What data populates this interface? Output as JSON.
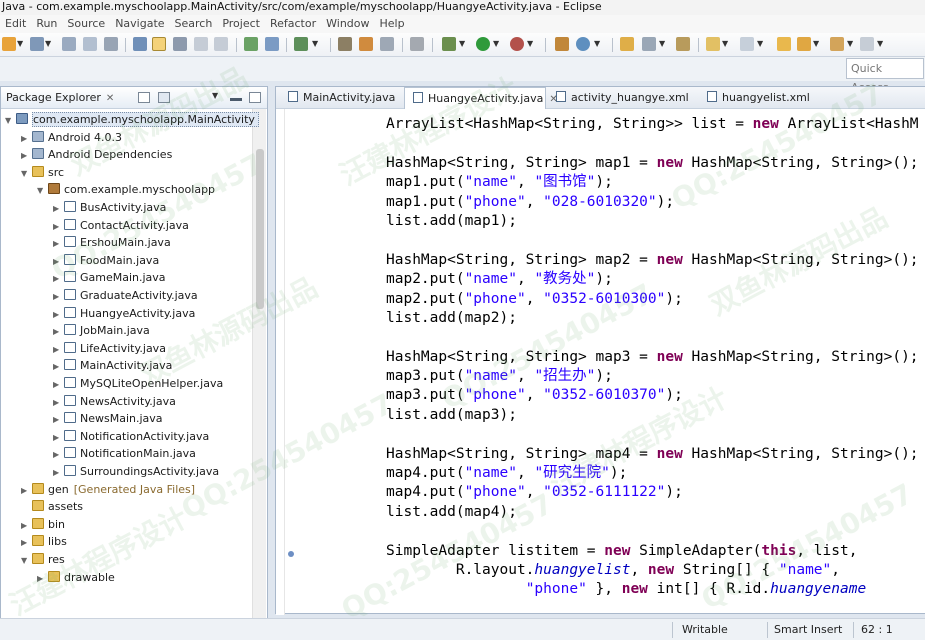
{
  "title": "Java - com.example.myschoolapp.MainActivity/src/com/example/myschoolapp/HuangyeActivity.java - Eclipse",
  "menu": [
    "Edit",
    "Run",
    "Source",
    "Navigate",
    "Search",
    "Project",
    "Refactor",
    "Window",
    "Help"
  ],
  "quick_access": "Quick Access",
  "package_explorer": {
    "tab_label": "Package Explorer",
    "tree": [
      {
        "label": "com.example.myschoolapp.MainActivity",
        "indent": 0,
        "icon": "project-icon",
        "arrow": "▼",
        "selected": true
      },
      {
        "label": "Android 4.0.3",
        "indent": 1,
        "icon": "library-icon",
        "arrow": "▶"
      },
      {
        "label": "Android Dependencies",
        "indent": 1,
        "icon": "library-icon",
        "arrow": "▶"
      },
      {
        "label": "src",
        "indent": 1,
        "icon": "folder-icon",
        "arrow": "▼"
      },
      {
        "label": "com.example.myschoolapp",
        "indent": 2,
        "icon": "package-icon",
        "arrow": "▼"
      },
      {
        "label": "BusActivity.java",
        "indent": 3,
        "icon": "java-file-icon",
        "arrow": "▶"
      },
      {
        "label": "ContactActivity.java",
        "indent": 3,
        "icon": "java-file-icon",
        "arrow": "▶"
      },
      {
        "label": "ErshouMain.java",
        "indent": 3,
        "icon": "java-file-icon",
        "arrow": "▶"
      },
      {
        "label": "FoodMain.java",
        "indent": 3,
        "icon": "java-file-icon",
        "arrow": "▶"
      },
      {
        "label": "GameMain.java",
        "indent": 3,
        "icon": "java-file-icon",
        "arrow": "▶"
      },
      {
        "label": "GraduateActivity.java",
        "indent": 3,
        "icon": "java-file-icon",
        "arrow": "▶"
      },
      {
        "label": "HuangyeActivity.java",
        "indent": 3,
        "icon": "java-file-icon",
        "arrow": "▶"
      },
      {
        "label": "JobMain.java",
        "indent": 3,
        "icon": "java-file-icon",
        "arrow": "▶"
      },
      {
        "label": "LifeActivity.java",
        "indent": 3,
        "icon": "java-file-icon",
        "arrow": "▶"
      },
      {
        "label": "MainActivity.java",
        "indent": 3,
        "icon": "java-file-icon",
        "arrow": "▶"
      },
      {
        "label": "MySQLiteOpenHelper.java",
        "indent": 3,
        "icon": "java-file-icon",
        "arrow": "▶"
      },
      {
        "label": "NewsActivity.java",
        "indent": 3,
        "icon": "java-file-icon",
        "arrow": "▶"
      },
      {
        "label": "NewsMain.java",
        "indent": 3,
        "icon": "java-file-icon",
        "arrow": "▶"
      },
      {
        "label": "NotificationActivity.java",
        "indent": 3,
        "icon": "java-file-icon",
        "arrow": "▶"
      },
      {
        "label": "NotificationMain.java",
        "indent": 3,
        "icon": "java-file-icon",
        "arrow": "▶"
      },
      {
        "label": "SurroundingsActivity.java",
        "indent": 3,
        "icon": "java-file-icon",
        "arrow": "▶"
      },
      {
        "label": "gen",
        "note": "[Generated Java Files]",
        "indent": 1,
        "icon": "folder-icon",
        "arrow": "▶"
      },
      {
        "label": "assets",
        "indent": 1,
        "icon": "folder-icon",
        "arrow": ""
      },
      {
        "label": "bin",
        "indent": 1,
        "icon": "folder-icon",
        "arrow": "▶"
      },
      {
        "label": "libs",
        "indent": 1,
        "icon": "folder-icon",
        "arrow": "▶"
      },
      {
        "label": "res",
        "indent": 1,
        "icon": "folder-icon",
        "arrow": "▼"
      },
      {
        "label": "drawable",
        "indent": 2,
        "icon": "folder-icon",
        "arrow": "▶"
      }
    ]
  },
  "editor": {
    "tabs": [
      {
        "label": "MainActivity.java",
        "active": false
      },
      {
        "label": "HuangyeActivity.java",
        "active": true
      },
      {
        "label": "activity_huangye.xml",
        "active": false
      },
      {
        "label": "huangyelist.xml",
        "active": false
      }
    ],
    "code_lines": [
      [
        [
          "t",
          "ArrayList<HashMap<String, String>> list = "
        ],
        [
          "k",
          "new"
        ],
        [
          "t",
          " ArrayList<HashM"
        ]
      ],
      [
        [
          "t",
          ""
        ]
      ],
      [
        [
          "t",
          "HashMap<String, String> map1 = "
        ],
        [
          "k",
          "new"
        ],
        [
          "t",
          " HashMap<String, String>();"
        ]
      ],
      [
        [
          "t",
          "map1.put("
        ],
        [
          "s",
          "\"name\""
        ],
        [
          "t",
          ", "
        ],
        [
          "s",
          "\"图书馆\""
        ],
        [
          "t",
          ");"
        ]
      ],
      [
        [
          "t",
          "map1.put("
        ],
        [
          "s",
          "\"phone\""
        ],
        [
          "t",
          ", "
        ],
        [
          "s",
          "\"028-6010320\""
        ],
        [
          "t",
          ");"
        ]
      ],
      [
        [
          "t",
          "list.add(map1);"
        ]
      ],
      [
        [
          "t",
          ""
        ]
      ],
      [
        [
          "t",
          "HashMap<String, String> map2 = "
        ],
        [
          "k",
          "new"
        ],
        [
          "t",
          " HashMap<String, String>();"
        ]
      ],
      [
        [
          "t",
          "map2.put("
        ],
        [
          "s",
          "\"name\""
        ],
        [
          "t",
          ", "
        ],
        [
          "s",
          "\"教务处\""
        ],
        [
          "t",
          ");"
        ]
      ],
      [
        [
          "t",
          "map2.put("
        ],
        [
          "s",
          "\"phone\""
        ],
        [
          "t",
          ", "
        ],
        [
          "s",
          "\"0352-6010300\""
        ],
        [
          "t",
          ");"
        ]
      ],
      [
        [
          "t",
          "list.add(map2);"
        ]
      ],
      [
        [
          "t",
          ""
        ]
      ],
      [
        [
          "t",
          "HashMap<String, String> map3 = "
        ],
        [
          "k",
          "new"
        ],
        [
          "t",
          " HashMap<String, String>();"
        ]
      ],
      [
        [
          "t",
          "map3.put("
        ],
        [
          "s",
          "\"name\""
        ],
        [
          "t",
          ", "
        ],
        [
          "s",
          "\"招生办\""
        ],
        [
          "t",
          ");"
        ]
      ],
      [
        [
          "t",
          "map3.put("
        ],
        [
          "s",
          "\"phone\""
        ],
        [
          "t",
          ", "
        ],
        [
          "s",
          "\"0352-6010370\""
        ],
        [
          "t",
          ");"
        ]
      ],
      [
        [
          "t",
          "list.add(map3);"
        ]
      ],
      [
        [
          "t",
          ""
        ]
      ],
      [
        [
          "t",
          "HashMap<String, String> map4 = "
        ],
        [
          "k",
          "new"
        ],
        [
          "t",
          " HashMap<String, String>();"
        ]
      ],
      [
        [
          "t",
          "map4.put("
        ],
        [
          "s",
          "\"name\""
        ],
        [
          "t",
          ", "
        ],
        [
          "s",
          "\"研究生院\""
        ],
        [
          "t",
          ");"
        ]
      ],
      [
        [
          "t",
          "map4.put("
        ],
        [
          "s",
          "\"phone\""
        ],
        [
          "t",
          ", "
        ],
        [
          "s",
          "\"0352-6111122\""
        ],
        [
          "t",
          ");"
        ]
      ],
      [
        [
          "t",
          "list.add(map4);"
        ]
      ],
      [
        [
          "t",
          ""
        ]
      ],
      [
        [
          "t",
          "SimpleAdapter listitem = "
        ],
        [
          "k",
          "new"
        ],
        [
          "t",
          " SimpleAdapter("
        ],
        [
          "k",
          "this"
        ],
        [
          "t",
          ", list,"
        ]
      ],
      [
        [
          "t",
          "        R.layout."
        ],
        [
          "i",
          "huangyelist"
        ],
        [
          "t",
          ", "
        ],
        [
          "k",
          "new"
        ],
        [
          "t",
          " String[] { "
        ],
        [
          "s",
          "\"name\""
        ],
        [
          "t",
          ","
        ]
      ],
      [
        [
          "t",
          "                "
        ],
        [
          "s",
          "\"phone\""
        ],
        [
          "t",
          " }, "
        ],
        [
          "k",
          "new"
        ],
        [
          "t",
          " int[] { R.id."
        ],
        [
          "i",
          "huangyename"
        ]
      ]
    ]
  },
  "status": {
    "mode": "Writable",
    "insert": "Smart Insert",
    "position": "62 : 1"
  },
  "watermarks": [
    "双鱼林源码出品",
    "汪建林程序设计",
    "QQ:254540457"
  ]
}
